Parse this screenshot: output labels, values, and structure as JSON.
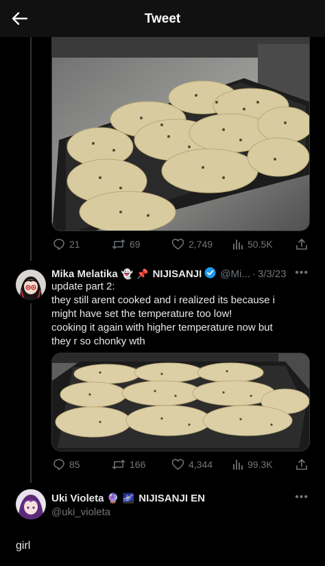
{
  "header": {
    "title": "Tweet"
  },
  "tweet1": {
    "stats": {
      "replies": "21",
      "retweets": "69",
      "likes": "2,749",
      "views": "50.5K"
    }
  },
  "tweet2": {
    "display_name": "Mika Melatika",
    "emoji": [
      "👻",
      "📌"
    ],
    "affiliation": "NIJISANJI",
    "handle": "@Mi...",
    "date": "3/3/23",
    "text_lines": [
      "update part 2:",
      "they still arent cooked and i realized its because i",
      "might have set the temperature too low!",
      "cooking it again with higher temperature now but",
      "they r so chonky wth"
    ],
    "stats": {
      "replies": "85",
      "retweets": "166",
      "likes": "4,344",
      "views": "99.3K"
    }
  },
  "reply": {
    "display_name": "Uki Violeta",
    "emoji": [
      "🔮",
      "🌌"
    ],
    "affiliation": "NIJISANJI EN",
    "handle": "@uki_violeta",
    "text": "girl"
  },
  "colors": {
    "background": "#000000",
    "muted": "#71767b",
    "verified": "#1d9bf0"
  }
}
